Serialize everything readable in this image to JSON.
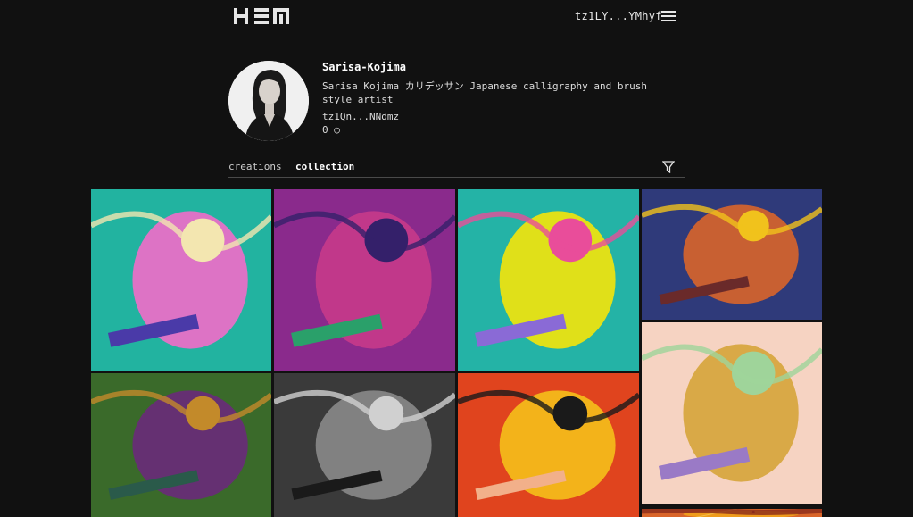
{
  "header": {
    "logo_icon": "hen-logo-icon",
    "wallet_address": "tz1LY...YMhyf",
    "menu_icon": "hamburger-menu-icon"
  },
  "profile": {
    "name": "Sarisa-Kojima",
    "bio": "Sarisa Kojima カリデッサン Japanese calligraphy and brush style artist",
    "address": "tz1Qn...NNdmz",
    "balance": "0 ○"
  },
  "tabs": [
    {
      "label": "creations",
      "active": false
    },
    {
      "label": "collection",
      "active": true
    }
  ],
  "filter_icon": "filter-funnel-icon",
  "colors": {
    "background": "#111111",
    "text": "#e6e6e6",
    "divider": "#4a4a4a"
  },
  "artworks": [
    {
      "name": "artwork-pink-figure-train",
      "palette": [
        "#22b3a0",
        "#f26cc9",
        "#f3e6b0",
        "#4a3aa8"
      ]
    },
    {
      "name": "artwork-alien-bedroom",
      "palette": [
        "#8a2a8c",
        "#c73a8a",
        "#34206a",
        "#2aa06a"
      ]
    },
    {
      "name": "artwork-skirt-spotlight",
      "palette": [
        "#24b3a6",
        "#f5e40a",
        "#e94d9a",
        "#8a6ad6"
      ]
    },
    {
      "name": "artwork-psychedelic-face",
      "palette": [
        "#2f3a7a",
        "#d9652a",
        "#f1c21c",
        "#6a2a2a"
      ]
    },
    {
      "name": "artwork-psychedelic-green",
      "palette": [
        "#3a6a2a",
        "#6a2a7a",
        "#c38a2a",
        "#2a5a4a"
      ]
    },
    {
      "name": "artwork-grayscale-doll",
      "palette": [
        "#3a3a3a",
        "#8a8a8a",
        "#d0d0d0",
        "#1a1a1a"
      ]
    },
    {
      "name": "artwork-bucket-hat-girl",
      "palette": [
        "#e0441e",
        "#f5c01a",
        "#1a1a1a",
        "#f2b08a"
      ]
    },
    {
      "name": "artwork-clocks-birds",
      "palette": [
        "#f6d3c2",
        "#d6a43a",
        "#9fd49a",
        "#9a7ac6"
      ]
    },
    {
      "name": "artwork-orange-partial",
      "palette": [
        "#d9652a",
        "#f1a21c",
        "#8a2a1a",
        "#f5c04a"
      ]
    }
  ]
}
